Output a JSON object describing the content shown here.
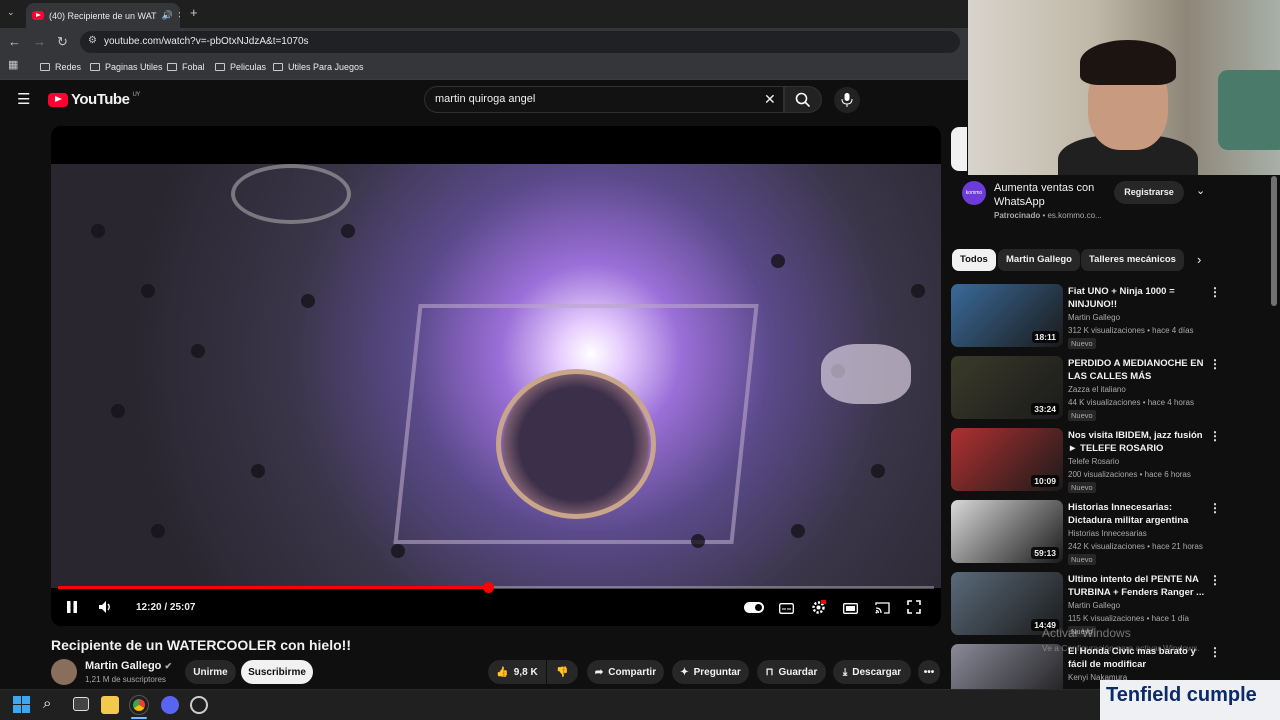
{
  "browser": {
    "tab_title": "(40) Recipiente de un WAT",
    "url": "youtube.com/watch?v=-pbOtxNJdzA&t=1070s",
    "bookmarks": [
      "Redes",
      "Paginas Utiles",
      "Fobal",
      "Peliculas",
      "Utiles Para Juegos"
    ]
  },
  "youtube": {
    "logo_text": "YouTube",
    "logo_country": "UY",
    "search_value": "martin quiroga angel"
  },
  "player": {
    "time": "12:20 / 25:07",
    "progress": 0.491
  },
  "video": {
    "title": "Recipiente de un WATERCOOLER con hielo!!",
    "channel": "Martin Gallego",
    "subscribers": "1,21 M de suscriptores",
    "join_label": "Unirme",
    "subscribe_label": "Suscribirme",
    "likes": "9,8 K",
    "share_label": "Compartir",
    "ask_label": "Preguntar",
    "save_label": "Guardar",
    "download_label": "Descargar"
  },
  "ad": {
    "title": "Aumenta ventas con WhatsApp",
    "sponsored": "Patrocinado",
    "domain": "es.kommo.co...",
    "button": "Registrarse",
    "icon_text": "kommo"
  },
  "chips": [
    "Todos",
    "Martin Gallego",
    "Talleres mecánicos"
  ],
  "recommendations": [
    {
      "title": "Fiat UNO + Ninja 1000 = NINJUNO!!",
      "channel": "Martin Gallego",
      "meta": "312 K visualizaciones • hace 4 días",
      "badge": "Nuevo",
      "duration": "18:11",
      "color": "#3a6a9a"
    },
    {
      "title": "PERDIDO A MEDIANOCHE EN LAS CALLES MÁS PELIGROSA...",
      "channel": "Zazza el italiano",
      "meta": "44 K visualizaciones • hace 4 horas",
      "badge": "Nuevo",
      "duration": "33:24",
      "color": "#3a3a2a"
    },
    {
      "title": "Nos visita IBIDEM, jazz fusión ► TELEFE ROSARIO",
      "channel": "Telefe Rosario",
      "meta": "200 visualizaciones • hace 6 horas",
      "badge": "Nuevo",
      "duration": "10:09",
      "color": "#b03030"
    },
    {
      "title": "Historias Innecesarias: Dictadura militar argentina",
      "channel": "Historias Innecesarias",
      "meta": "242 K visualizaciones • hace 21 horas",
      "badge": "Nuevo",
      "duration": "59:13",
      "color": "#d8d8d8"
    },
    {
      "title": "Ultimo intento del PENTE NA TURBINA + Fenders Ranger ...",
      "channel": "Martin Gallego",
      "meta": "115 K visualizaciones • hace 1 día",
      "badge": "Nuevo",
      "duration": "14:49",
      "color": "#5a6a7a"
    },
    {
      "title": "El Honda Civic mas barato y fácil de modificar",
      "channel": "Kenyi Nakamura",
      "meta": "",
      "badge": "",
      "duration": "",
      "color": "#8a8a9a"
    }
  ],
  "overlay": {
    "activate_title": "Activar Windows",
    "activate_sub": "Ve a Configuración para activar Windows.",
    "banner": "Tenfield cumple"
  }
}
